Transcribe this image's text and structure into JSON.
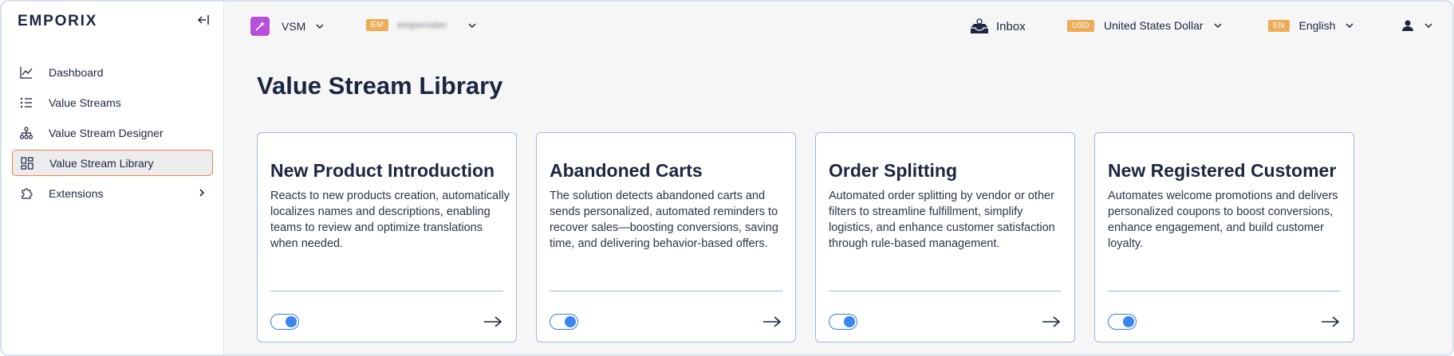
{
  "sidebar": {
    "logo": "EMPORIX",
    "items": [
      {
        "label": "Dashboard",
        "icon": "chart-line-icon"
      },
      {
        "label": "Value Streams",
        "icon": "list-icon"
      },
      {
        "label": "Value Stream Designer",
        "icon": "hierarchy-icon"
      },
      {
        "label": "Value Stream Library",
        "icon": "grid-icon",
        "active": true
      },
      {
        "label": "Extensions",
        "icon": "puzzle-icon",
        "has_submenu": true
      }
    ]
  },
  "topbar": {
    "app": {
      "label": "VSM",
      "icon_color": "#b84fdb"
    },
    "tenant": {
      "badge": "EM",
      "name": "emporixdev"
    },
    "inbox": {
      "label": "Inbox"
    },
    "currency": {
      "badge": "USD",
      "label": "United States Dollar"
    },
    "language": {
      "badge": "EN",
      "label": "English"
    }
  },
  "main": {
    "title": "Value Stream Library",
    "cards": [
      {
        "title": "New Product Introduction",
        "description": "Reacts to new products creation, automatically localizes names and descriptions, enabling teams to review and optimize translations when needed.",
        "enabled": true
      },
      {
        "title": "Abandoned Carts",
        "description": "The solution detects abandoned carts and sends personalized, automated reminders to recover sales—boosting conversions, saving time, and delivering behavior-based offers.",
        "enabled": true
      },
      {
        "title": "Order Splitting",
        "description": "Automated order splitting by vendor or other filters to streamline fulfillment, simplify logistics, and enhance customer satisfaction through rule-based management.",
        "enabled": true
      },
      {
        "title": "New Registered Customer",
        "description": "Automates welcome promotions and delivers personalized coupons to boost conversions, enhance engagement, and build customer loyalty.",
        "enabled": true
      }
    ]
  },
  "colors": {
    "accent": "#3a86ee",
    "badge": "#efac57",
    "active_border": "#e8823f",
    "text": "#1b2740"
  }
}
